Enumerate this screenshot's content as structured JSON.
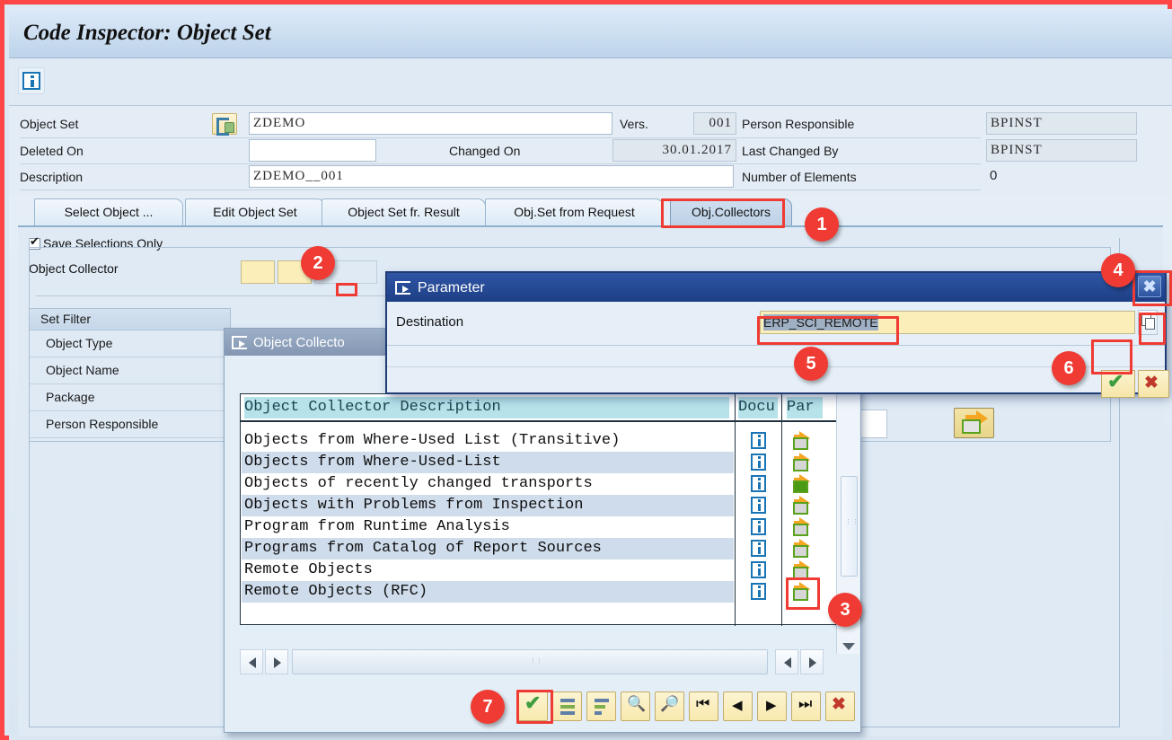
{
  "window": {
    "title": "Code Inspector: Object Set",
    "toolbar_info_icon": "info-icon"
  },
  "header_form": {
    "rows": [
      {
        "label": "Object Set",
        "value": "ZDEMO",
        "label2": "Vers.",
        "value2": "001",
        "label3": "Person Responsible",
        "value3": "BPINST"
      },
      {
        "label": "Deleted On",
        "value": "",
        "label2": "Changed On",
        "value2": "30.01.2017",
        "label3": "Last Changed By",
        "value3": "BPINST"
      },
      {
        "label": "Description",
        "value": "ZDEMO__001",
        "label2": "",
        "value2": "",
        "label3": "Number of Elements",
        "value3": "0"
      }
    ]
  },
  "tabs": [
    {
      "label": "Select Object ...",
      "selected": false
    },
    {
      "label": "Edit Object Set",
      "selected": false
    },
    {
      "label": "Object Set fr. Result",
      "selected": false
    },
    {
      "label": "Obj.Set from Request",
      "selected": false
    },
    {
      "label": "Obj.Collectors",
      "selected": true
    }
  ],
  "body": {
    "save_selections_label": "Save Selections Only",
    "save_selections_checked": true,
    "object_collector_label": "Object Collector",
    "set_filter": {
      "header": "Set Filter",
      "items": [
        "Object Type",
        "Object Name",
        "Package",
        "Person Responsible"
      ]
    }
  },
  "object_collector_dialog": {
    "title": "Object Collecto",
    "columns": [
      "Object Collector Description",
      "Docu",
      "Par"
    ],
    "rows": [
      {
        "description": "Objects from Where-Used List (Transitive)",
        "docu": "info-icon",
        "par": "parameter-icon"
      },
      {
        "description": "Objects from Where-Used-List",
        "docu": "info-icon",
        "par": "parameter-icon"
      },
      {
        "description": "Objects of recently changed transports",
        "docu": "info-icon",
        "par": "parameter-icon-filled"
      },
      {
        "description": "Objects with Problems from Inspection",
        "docu": "info-icon",
        "par": "parameter-icon"
      },
      {
        "description": "Program from Runtime Analysis",
        "docu": "info-icon",
        "par": "parameter-icon"
      },
      {
        "description": "Programs from Catalog of Report Sources",
        "docu": "info-icon",
        "par": "parameter-icon"
      },
      {
        "description": "Remote Objects",
        "docu": "info-icon",
        "par": "parameter-icon"
      },
      {
        "description": "Remote Objects (RFC)",
        "docu": "info-icon",
        "par": "parameter-icon"
      }
    ],
    "toolbar": [
      {
        "name": "continue-button",
        "icon": "green-check-icon"
      },
      {
        "name": "sort-ascending-button",
        "icon": "sort-ascending-icon"
      },
      {
        "name": "sort-descending-button",
        "icon": "sort-descending-icon"
      },
      {
        "name": "find-button",
        "icon": "binoculars-icon"
      },
      {
        "name": "find-next-button",
        "icon": "binoculars-plus-icon"
      },
      {
        "name": "first-page-button",
        "icon": "first-page-icon"
      },
      {
        "name": "previous-page-button",
        "icon": "previous-page-icon"
      },
      {
        "name": "next-page-button",
        "icon": "next-page-icon"
      },
      {
        "name": "last-page-button",
        "icon": "last-page-icon"
      },
      {
        "name": "cancel-button",
        "icon": "red-x-icon"
      }
    ]
  },
  "parameter_dialog": {
    "title": "Parameter",
    "close_label": "✖",
    "destination_label": "Destination",
    "destination_value": "ERP_SCI_REMOTE",
    "picker_icon": "value-help-icon",
    "ok_icon": "green-check-icon",
    "cancel_icon": "red-x-icon"
  },
  "callouts": [
    {
      "number": "1",
      "target": "tab-obj-collectors"
    },
    {
      "number": "2",
      "target": "object-collector-value-help"
    },
    {
      "number": "3",
      "target": "parameter-icon-remote-objects-rfc"
    },
    {
      "number": "4",
      "target": "parameter-dialog-close-button"
    },
    {
      "number": "5",
      "target": "destination-input"
    },
    {
      "number": "6",
      "target": "parameter-dialog-ok-button"
    },
    {
      "number": "7",
      "target": "object-collector-continue-button"
    }
  ],
  "colors": {
    "accent_red": "#ef3b33",
    "dialog_active_blue": "#1d3f86",
    "dialog_inactive_blue": "#8496b2",
    "field_yellow": "#fbeeb9",
    "header_cyan": "#b6e3ea"
  }
}
